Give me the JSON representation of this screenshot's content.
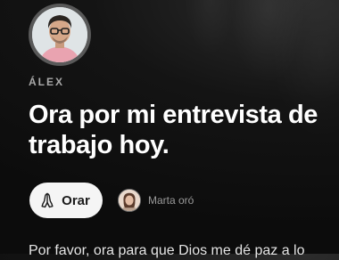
{
  "post": {
    "author": {
      "name": "ÁLEX",
      "avatar": "man-with-glasses-portrait"
    },
    "title": "Ora por mi entrevista de trabajo hoy.",
    "body": "Por favor, ora para que Dios me dé paz a lo"
  },
  "actions": {
    "pray_label": "Orar",
    "pray_icon": "praying-hands-icon"
  },
  "prayed_by": {
    "text": "Marta oró",
    "avatar": "woman-portrait"
  },
  "colors": {
    "background": "#141414",
    "button_bg": "#f5f5f5",
    "muted_text": "#a9a9a9"
  }
}
